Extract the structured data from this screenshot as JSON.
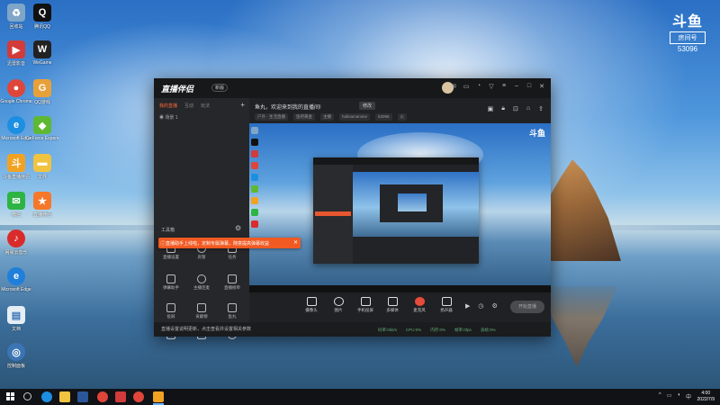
{
  "desktop": {
    "icons": [
      {
        "label": "回收站",
        "icon": "recycle-bin-icon",
        "color": "#7fa6c8"
      },
      {
        "label": "腾讯QQ",
        "icon": "qq-icon",
        "color": "#111111"
      },
      {
        "label": "迅雷影音",
        "icon": "player-icon",
        "color": "#d23b3b"
      },
      {
        "label": "WeGame",
        "icon": "wegame-icon",
        "color": "#222222"
      },
      {
        "label": "Google Chrome",
        "icon": "chrome-icon",
        "color": "#e0453a"
      },
      {
        "label": "QQ游戏",
        "icon": "qq-game-icon",
        "color": "#e8a13a"
      },
      {
        "label": "Microsoft Edge",
        "icon": "edge-icon",
        "color": "#1d8fe1"
      },
      {
        "label": "GeForce Experience",
        "icon": "geforce-icon",
        "color": "#5fb832"
      },
      {
        "label": "斗鱼直播伴侣",
        "icon": "douyu-icon",
        "color": "#f2a222"
      },
      {
        "label": "文件",
        "icon": "folder-icon",
        "color": "#f0c340"
      },
      {
        "label": "微信",
        "icon": "wechat-icon",
        "color": "#2db443"
      },
      {
        "label": "直播伴侣",
        "icon": "live-icon",
        "color": "#f5782a"
      },
      {
        "label": "网易云音乐",
        "icon": "netease-music-icon",
        "color": "#d92b2b"
      },
      {
        "label": "Microsoft Edge",
        "icon": "edge-icon",
        "color": "#1f7fdb"
      },
      {
        "label": "文档",
        "icon": "document-icon",
        "color": "#e6eef5"
      },
      {
        "label": "控制面板",
        "icon": "control-panel-icon",
        "color": "#3c75b5"
      }
    ]
  },
  "watermark": {
    "logo": "斗鱼",
    "box": "房间号",
    "number": "53096"
  },
  "app": {
    "brand": "直播伴侣",
    "version": "新版",
    "tabs": [
      "我的直播",
      "互动",
      "玩法"
    ],
    "active_tab": "我的直播",
    "scene": "场景 1",
    "tools_label": "工具箱",
    "tools": [
      {
        "label": "直播设置"
      },
      {
        "label": "房管"
      },
      {
        "label": "任务"
      },
      {
        "label": "弹幕助手"
      },
      {
        "label": "主播连麦"
      },
      {
        "label": "直播榜单"
      },
      {
        "label": "投屏"
      },
      {
        "label": "贡献榜"
      },
      {
        "label": "鱼丸"
      },
      {
        "label": "图文"
      },
      {
        "label": "礼物"
      },
      {
        "label": "直播回放"
      }
    ],
    "room_title": "鱼丸，欢迎来到我的直播间!",
    "edit_label": "修改",
    "meta": [
      "户外 · 生活直播",
      "鱼吧黄金",
      "主播",
      "halloamanime",
      "53096",
      "火"
    ],
    "banner": "直播助手上线啦，定制专属弹幕，随意提高弹幕收益",
    "controls": [
      {
        "label": "摄像头"
      },
      {
        "label": "图片"
      },
      {
        "label": "手机投屏"
      },
      {
        "label": "多媒体"
      },
      {
        "label": "麦克风"
      },
      {
        "label": "扬声器"
      }
    ],
    "start_label": "开始直播",
    "status": "直播设置说明更新，点击查看并设置相关参数",
    "stats": [
      "码率:0kb/s",
      "CPU:0%",
      "内存:0%",
      "帧率:0fps",
      "丢帧:0%"
    ]
  },
  "taskbar": {
    "time": "4:00",
    "date": "2022/7/9"
  }
}
